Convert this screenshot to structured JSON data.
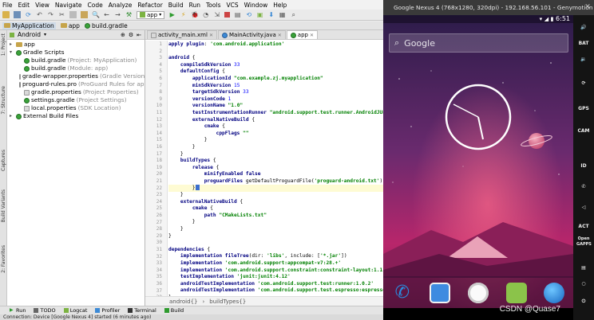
{
  "menu": {
    "items": [
      "File",
      "Edit",
      "View",
      "Navigate",
      "Code",
      "Analyze",
      "Refactor",
      "Build",
      "Run",
      "Tools",
      "VCS",
      "Window",
      "Help"
    ]
  },
  "toolbar": {
    "config": "app"
  },
  "nav": {
    "crumbs": [
      "MyApplication",
      "app",
      "build.gradle"
    ]
  },
  "left_strip": {
    "tabs": [
      "1: Project",
      "7: Structure",
      "Captures",
      "Build Variants",
      "2: Favorites"
    ]
  },
  "project": {
    "view_mode": "Android",
    "tree": [
      {
        "label": "app",
        "hint": "",
        "kind": "folder",
        "depth": 0,
        "arrow": "▸"
      },
      {
        "label": "Gradle Scripts",
        "hint": "",
        "kind": "gradle",
        "depth": 0,
        "arrow": "▾"
      },
      {
        "label": "build.gradle",
        "hint": "(Project: MyApplication)",
        "kind": "gradle",
        "depth": 1,
        "arrow": ""
      },
      {
        "label": "build.gradle",
        "hint": "(Module: app)",
        "kind": "gradle",
        "depth": 1,
        "arrow": ""
      },
      {
        "label": "gradle-wrapper.properties",
        "hint": "(Gradle Version)",
        "kind": "prop",
        "depth": 1,
        "arrow": ""
      },
      {
        "label": "proguard-rules.pro",
        "hint": "(ProGuard Rules for app)",
        "kind": "pro",
        "depth": 1,
        "arrow": ""
      },
      {
        "label": "gradle.properties",
        "hint": "(Project Properties)",
        "kind": "prop",
        "depth": 1,
        "arrow": ""
      },
      {
        "label": "settings.gradle",
        "hint": "(Project Settings)",
        "kind": "gradle",
        "depth": 1,
        "arrow": ""
      },
      {
        "label": "local.properties",
        "hint": "(SDK Location)",
        "kind": "prop",
        "depth": 1,
        "arrow": ""
      },
      {
        "label": "External Build Files",
        "hint": "",
        "kind": "gradle",
        "depth": 0,
        "arrow": "▸"
      }
    ]
  },
  "editor": {
    "tabs": [
      {
        "label": "activity_main.xml",
        "active": false
      },
      {
        "label": "MainActivity.java",
        "active": false
      },
      {
        "label": "app",
        "active": true
      }
    ],
    "code": [
      "apply plugin: 'com.android.application'",
      "",
      "android {",
      "    compileSdkVersion 33",
      "    defaultConfig {",
      "        applicationId \"com.example.zj.myapplication\"",
      "        minSdkVersion 15",
      "        targetSdkVersion 33",
      "        versionCode 1",
      "        versionName \"1.0\"",
      "        testInstrumentationRunner \"android.support.test.runner.AndroidJUnitRunner\"",
      "        externalNativeBuild {",
      "            cmake {",
      "                cppFlags \"\"",
      "            }",
      "        }",
      "    }",
      "    buildTypes {",
      "        release {",
      "            minifyEnabled false",
      "            proguardFiles getDefaultProguardFile('proguard-android.txt'), 'proguard-rules.pro'",
      "        }",
      "    }",
      "    externalNativeBuild {",
      "        cmake {",
      "            path \"CMakeLists.txt\"",
      "        }",
      "    }",
      "}",
      "",
      "dependencies {",
      "    implementation fileTree(dir: 'libs', include: ['*.jar'])",
      "    implementation 'com.android.support:appcompat-v7:28.+'",
      "    implementation 'com.android.support.constraint:constraint-layout:1.1.0'",
      "    testImplementation 'junit:junit:4.12'",
      "    androidTestImplementation 'com.android.support.test:runner:1.0.2'",
      "    androidTestImplementation 'com.android.support.test.espresso:espresso-core:3.0.2'",
      "}"
    ],
    "breadcrumb": [
      "android{}",
      "buildTypes{}"
    ]
  },
  "toolwindows": [
    "Run",
    "TODO",
    "Logcat",
    "Profiler",
    "Terminal",
    "Build"
  ],
  "status_text": "Connection: Device [Google Nexus 4] started (6 minutes ago)",
  "emulator": {
    "title": "Google Nexus 4 (768x1280, 320dpi) - 192.168.56.101 - Genymotion",
    "clock": "6:51",
    "search_placeholder": "Google",
    "side_buttons": [
      "BAT",
      "GPS",
      "CAM",
      "ID",
      "ACT",
      "Open GAPPS"
    ],
    "dock": [
      "phone-icon",
      "contacts-icon",
      "apps-drawer-icon",
      "android-icon",
      "globe-icon"
    ]
  },
  "watermark": "CSDN @Quase7",
  "colors": {
    "accent": "#3c6fcf",
    "emu_bg_top": "#331f52",
    "emu_bg_bottom": "#d0246c"
  }
}
